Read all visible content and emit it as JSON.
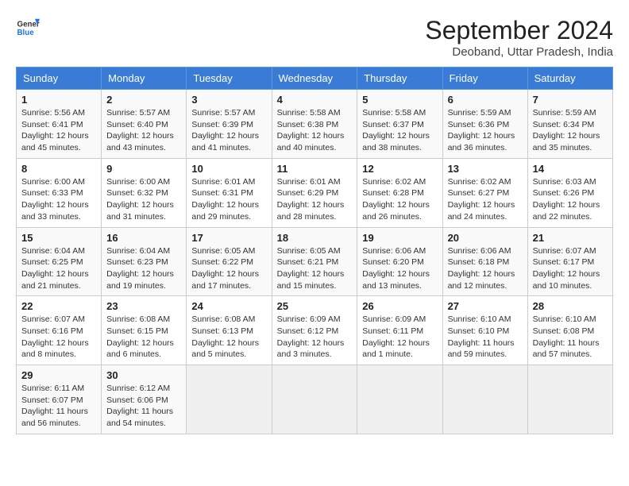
{
  "header": {
    "logo_general": "General",
    "logo_blue": "Blue",
    "main_title": "September 2024",
    "subtitle": "Deoband, Uttar Pradesh, India"
  },
  "days_of_week": [
    "Sunday",
    "Monday",
    "Tuesday",
    "Wednesday",
    "Thursday",
    "Friday",
    "Saturday"
  ],
  "weeks": [
    [
      {
        "day": "1",
        "info": "Sunrise: 5:56 AM\nSunset: 6:41 PM\nDaylight: 12 hours\nand 45 minutes."
      },
      {
        "day": "2",
        "info": "Sunrise: 5:57 AM\nSunset: 6:40 PM\nDaylight: 12 hours\nand 43 minutes."
      },
      {
        "day": "3",
        "info": "Sunrise: 5:57 AM\nSunset: 6:39 PM\nDaylight: 12 hours\nand 41 minutes."
      },
      {
        "day": "4",
        "info": "Sunrise: 5:58 AM\nSunset: 6:38 PM\nDaylight: 12 hours\nand 40 minutes."
      },
      {
        "day": "5",
        "info": "Sunrise: 5:58 AM\nSunset: 6:37 PM\nDaylight: 12 hours\nand 38 minutes."
      },
      {
        "day": "6",
        "info": "Sunrise: 5:59 AM\nSunset: 6:36 PM\nDaylight: 12 hours\nand 36 minutes."
      },
      {
        "day": "7",
        "info": "Sunrise: 5:59 AM\nSunset: 6:34 PM\nDaylight: 12 hours\nand 35 minutes."
      }
    ],
    [
      {
        "day": "8",
        "info": "Sunrise: 6:00 AM\nSunset: 6:33 PM\nDaylight: 12 hours\nand 33 minutes."
      },
      {
        "day": "9",
        "info": "Sunrise: 6:00 AM\nSunset: 6:32 PM\nDaylight: 12 hours\nand 31 minutes."
      },
      {
        "day": "10",
        "info": "Sunrise: 6:01 AM\nSunset: 6:31 PM\nDaylight: 12 hours\nand 29 minutes."
      },
      {
        "day": "11",
        "info": "Sunrise: 6:01 AM\nSunset: 6:29 PM\nDaylight: 12 hours\nand 28 minutes."
      },
      {
        "day": "12",
        "info": "Sunrise: 6:02 AM\nSunset: 6:28 PM\nDaylight: 12 hours\nand 26 minutes."
      },
      {
        "day": "13",
        "info": "Sunrise: 6:02 AM\nSunset: 6:27 PM\nDaylight: 12 hours\nand 24 minutes."
      },
      {
        "day": "14",
        "info": "Sunrise: 6:03 AM\nSunset: 6:26 PM\nDaylight: 12 hours\nand 22 minutes."
      }
    ],
    [
      {
        "day": "15",
        "info": "Sunrise: 6:04 AM\nSunset: 6:25 PM\nDaylight: 12 hours\nand 21 minutes."
      },
      {
        "day": "16",
        "info": "Sunrise: 6:04 AM\nSunset: 6:23 PM\nDaylight: 12 hours\nand 19 minutes."
      },
      {
        "day": "17",
        "info": "Sunrise: 6:05 AM\nSunset: 6:22 PM\nDaylight: 12 hours\nand 17 minutes."
      },
      {
        "day": "18",
        "info": "Sunrise: 6:05 AM\nSunset: 6:21 PM\nDaylight: 12 hours\nand 15 minutes."
      },
      {
        "day": "19",
        "info": "Sunrise: 6:06 AM\nSunset: 6:20 PM\nDaylight: 12 hours\nand 13 minutes."
      },
      {
        "day": "20",
        "info": "Sunrise: 6:06 AM\nSunset: 6:18 PM\nDaylight: 12 hours\nand 12 minutes."
      },
      {
        "day": "21",
        "info": "Sunrise: 6:07 AM\nSunset: 6:17 PM\nDaylight: 12 hours\nand 10 minutes."
      }
    ],
    [
      {
        "day": "22",
        "info": "Sunrise: 6:07 AM\nSunset: 6:16 PM\nDaylight: 12 hours\nand 8 minutes."
      },
      {
        "day": "23",
        "info": "Sunrise: 6:08 AM\nSunset: 6:15 PM\nDaylight: 12 hours\nand 6 minutes."
      },
      {
        "day": "24",
        "info": "Sunrise: 6:08 AM\nSunset: 6:13 PM\nDaylight: 12 hours\nand 5 minutes."
      },
      {
        "day": "25",
        "info": "Sunrise: 6:09 AM\nSunset: 6:12 PM\nDaylight: 12 hours\nand 3 minutes."
      },
      {
        "day": "26",
        "info": "Sunrise: 6:09 AM\nSunset: 6:11 PM\nDaylight: 12 hours\nand 1 minute."
      },
      {
        "day": "27",
        "info": "Sunrise: 6:10 AM\nSunset: 6:10 PM\nDaylight: 11 hours\nand 59 minutes."
      },
      {
        "day": "28",
        "info": "Sunrise: 6:10 AM\nSunset: 6:08 PM\nDaylight: 11 hours\nand 57 minutes."
      }
    ],
    [
      {
        "day": "29",
        "info": "Sunrise: 6:11 AM\nSunset: 6:07 PM\nDaylight: 11 hours\nand 56 minutes."
      },
      {
        "day": "30",
        "info": "Sunrise: 6:12 AM\nSunset: 6:06 PM\nDaylight: 11 hours\nand 54 minutes."
      },
      null,
      null,
      null,
      null,
      null
    ]
  ]
}
